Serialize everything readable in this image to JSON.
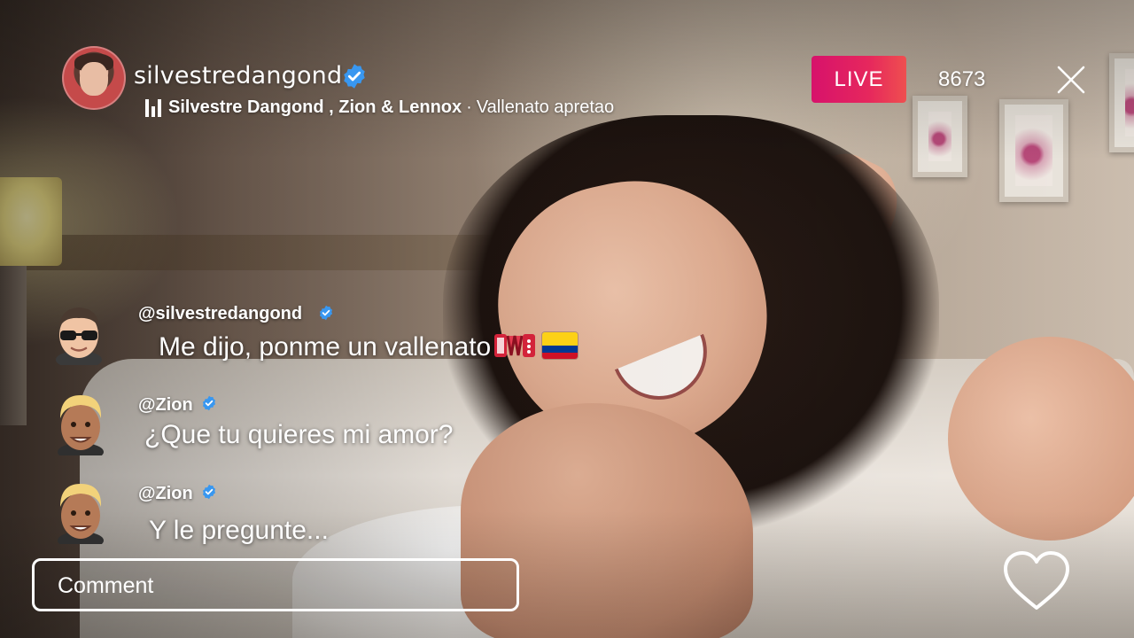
{
  "host": {
    "username": "silvestredangond",
    "verified": true
  },
  "now_playing": {
    "icon": "equalizer-icon",
    "artists": "Silvestre Dangond , Zion & Lennox",
    "separator": "·",
    "title": "Vallenato apretao"
  },
  "live": {
    "badge": "LIVE",
    "viewers": "8673",
    "badge_color": "#e0175f"
  },
  "comments": [
    {
      "user": "@silvestredangond",
      "verified": true,
      "text": "Me dijo, ponme un vallenato",
      "emojis": [
        "accordion-icon",
        "colombia-flag-icon"
      ]
    },
    {
      "user": "@Zion",
      "verified": true,
      "text": "¿Que tu quieres mi amor?"
    },
    {
      "user": "@Zion",
      "verified": true,
      "text": "Y le pregunte..."
    }
  ],
  "composer": {
    "placeholder": "Comment"
  },
  "colors": {
    "verified": "#3897f0"
  }
}
